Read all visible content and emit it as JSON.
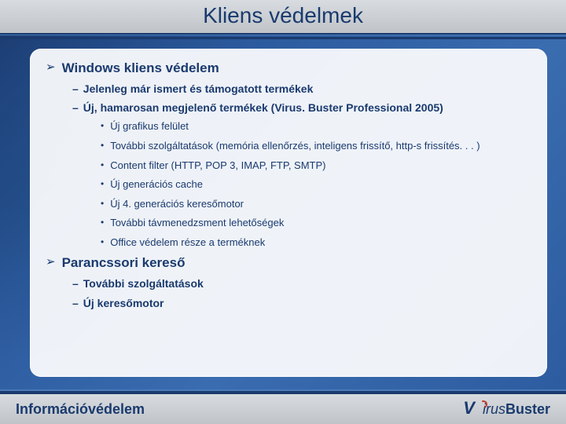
{
  "title": "Kliens védelmek",
  "sections": [
    {
      "heading": "Windows kliens védelem",
      "items": [
        {
          "text": "Jelenleg már ismert és támogatott termékek"
        },
        {
          "text": "Új, hamarosan megjelenő termékek (Virus. Buster Professional 2005)",
          "sub": [
            "Új grafikus felület",
            "További szolgáltatások (memória ellenőrzés, inteligens frissítő, http-s frissítés. . . )",
            "Content filter (HTTP, POP 3, IMAP, FTP, SMTP)",
            "Új generációs cache",
            "Új 4. generációs keresőmotor",
            "További távmenedzsment lehetőségek",
            "Office védelem része a terméknek"
          ]
        }
      ]
    },
    {
      "heading": "Parancssori kereső",
      "items": [
        {
          "text": "További szolgáltatások"
        },
        {
          "text": "Új keresőmotor"
        }
      ]
    }
  ],
  "footer": {
    "title": "Információvédelem",
    "logo": {
      "v": "V",
      "irus": "irus",
      "buster": "Buster"
    }
  }
}
